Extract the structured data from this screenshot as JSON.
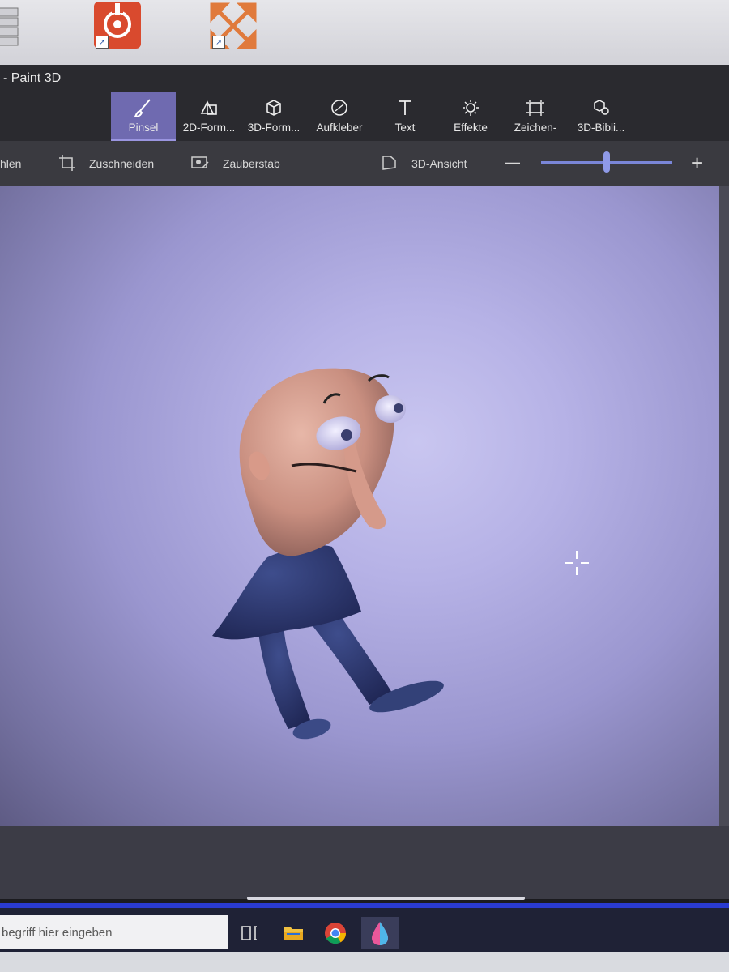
{
  "app": {
    "title": "- Paint 3D"
  },
  "ribbon": {
    "tools": [
      {
        "label": "Pinsel",
        "icon": "brush-icon",
        "active": true
      },
      {
        "label": "2D-Form...",
        "icon": "2d-shapes-icon",
        "active": false
      },
      {
        "label": "3D-Form...",
        "icon": "3d-shapes-icon",
        "active": false
      },
      {
        "label": "Aufkleber",
        "icon": "stickers-icon",
        "active": false
      },
      {
        "label": "Text",
        "icon": "text-icon",
        "active": false
      },
      {
        "label": "Effekte",
        "icon": "effects-icon",
        "active": false
      },
      {
        "label": "Zeichen-",
        "icon": "canvas-icon",
        "active": false
      },
      {
        "label": "3D-Bibli...",
        "icon": "3d-library-icon",
        "active": false
      }
    ]
  },
  "toolbar2": {
    "select_label": "hlen",
    "crop_label": "Zuschneiden",
    "magic_select_label": "Zauberstab",
    "view3d_label": "3D-Ansicht",
    "zoom_out_symbol": "—",
    "zoom_in_symbol": "+",
    "zoom_level_fraction": 0.5
  },
  "taskbar": {
    "search_placeholder": "begriff hier eingeben",
    "items": [
      "task-view-icon",
      "file-explorer-icon",
      "chrome-icon",
      "paint3d-icon"
    ]
  },
  "colors": {
    "ribbon_bg": "#2a2a2f",
    "active_tool": "#6f6ab0",
    "accent": "#7a86d8",
    "taskbar_accent": "#2a3bd0"
  }
}
